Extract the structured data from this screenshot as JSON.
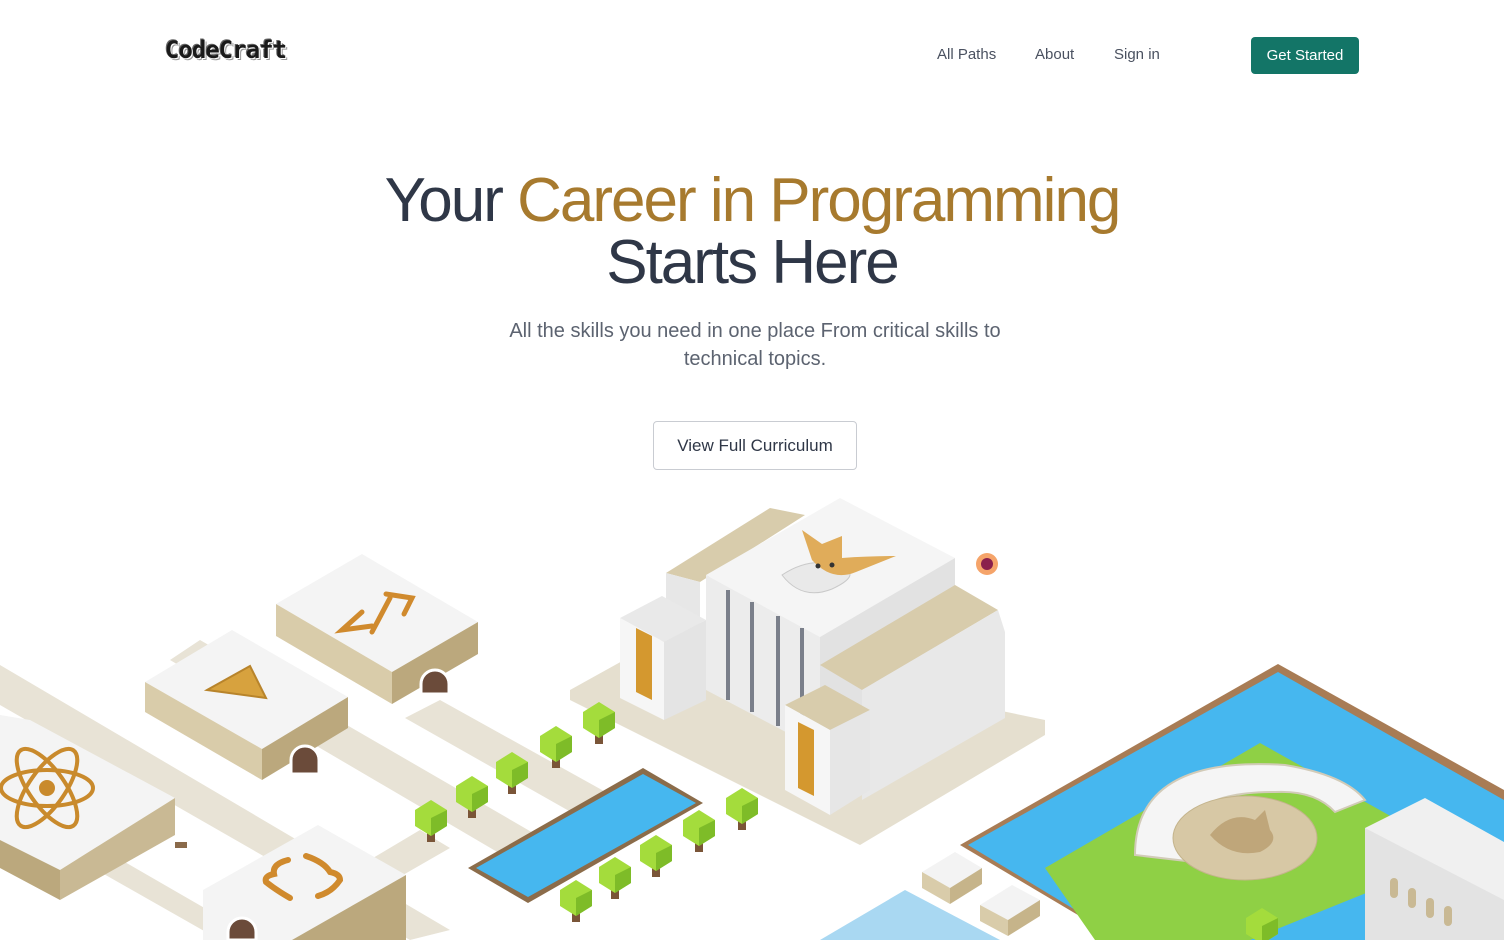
{
  "brand": {
    "logo_text": "CodeCraft"
  },
  "nav": {
    "items": [
      "All Paths",
      "About",
      "Sign in"
    ],
    "cta_label": "Get Started"
  },
  "hero": {
    "title_part1": "Your ",
    "title_accent": "Career in Programming",
    "title_part2": "Starts Here",
    "subtitle": "All the skills you need in one place From critical skills to technical topics.",
    "button_label": "View Full Curriculum"
  },
  "colors": {
    "accent_gold": "#a77a2e",
    "brand_teal": "#137567",
    "water_blue": "#45b5ee",
    "grass_green": "#8fd045",
    "block_tan": "#c8b48c"
  },
  "illustration": {
    "icons": [
      "atom-icon",
      "diamond-icon",
      "code-tag-icon",
      "curly-braces-icon",
      "bull-mascot-icon"
    ]
  }
}
